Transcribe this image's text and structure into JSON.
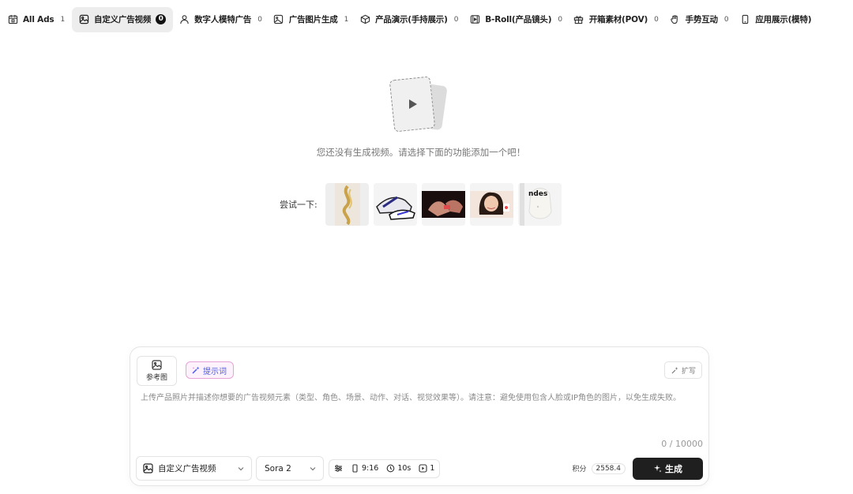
{
  "tabs": [
    {
      "label": "All Ads",
      "count": "1",
      "icon": "calendar-icon"
    },
    {
      "label": "自定义广告视频",
      "count": "0",
      "icon": "image-icon"
    },
    {
      "label": "数字人模特广告",
      "count": "0",
      "icon": "user-icon"
    },
    {
      "label": "广告图片生成",
      "count": "1",
      "icon": "picture-icon"
    },
    {
      "label": "产品演示(手持展示)",
      "count": "0",
      "icon": "cube-icon"
    },
    {
      "label": "B-Roll(产品镜头)",
      "count": "0",
      "icon": "film-icon"
    },
    {
      "label": "开箱素材(POV)",
      "count": "0",
      "icon": "gift-icon"
    },
    {
      "label": "手势互动",
      "count": "0",
      "icon": "hand-icon"
    },
    {
      "label": "应用展示(模特)",
      "count": "",
      "icon": "phone-icon"
    }
  ],
  "empty_state": {
    "message": "您还没有生成视频。请选择下面的功能添加一个吧！",
    "try_label": "尝试一下:"
  },
  "samples": [
    {
      "name": "gold-jewelry"
    },
    {
      "name": "sneakers"
    },
    {
      "name": "hands-product"
    },
    {
      "name": "girl-selfie"
    },
    {
      "name": "sweatshirt"
    }
  ],
  "composer": {
    "reference_label": "参考图",
    "prompt_chip_label": "提示词",
    "expand_label": "扩写",
    "placeholder": "上传产品照片并描述你想要的广告视频元素（类型、角色、场景、动作、对话、视觉效果等）。请注意：避免使用包含人脸或IP角色的图片，以免生成失败。",
    "char_count": "0 / 10000",
    "type_select": "自定义广告视频",
    "model_select": "Sora 2",
    "aspect_ratio": "9:16",
    "duration": "10s",
    "quantity": "1",
    "credits_label": "积分",
    "credits_value": "2558.4",
    "generate_label": "生成"
  }
}
